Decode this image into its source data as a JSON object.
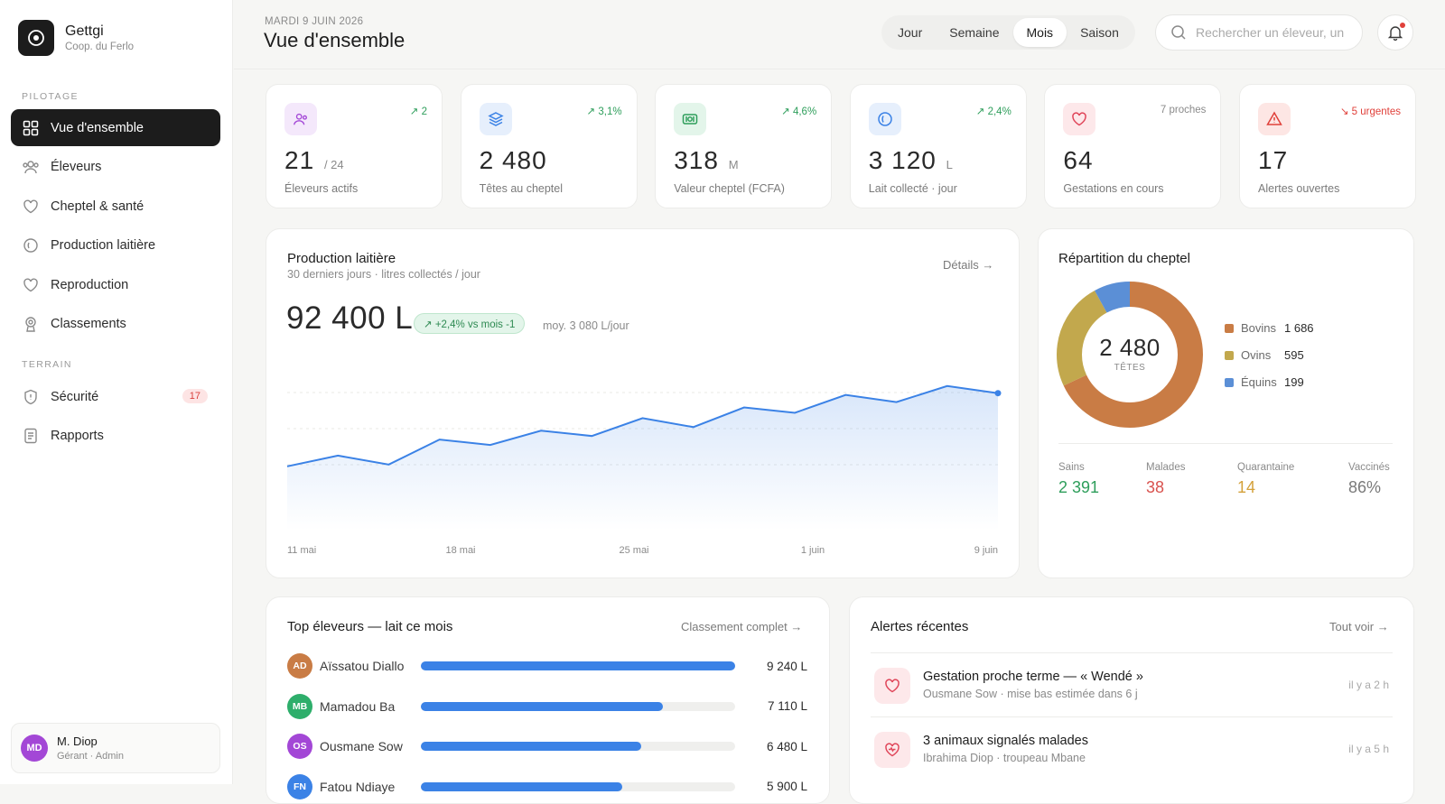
{
  "brand": {
    "name": "Gettgi",
    "sub": "Coop. du Ferlo"
  },
  "sidebar": {
    "section_pilotage": "PILOTAGE",
    "section_terrain": "TERRAIN",
    "items": [
      {
        "label": "Vue d'ensemble",
        "icon": "grid-icon"
      },
      {
        "label": "Éleveurs",
        "icon": "users-icon"
      },
      {
        "label": "Cheptel & santé",
        "icon": "heart-icon"
      },
      {
        "label": "Production laitière",
        "icon": "drop-icon"
      },
      {
        "label": "Reproduction",
        "icon": "heart-icon"
      },
      {
        "label": "Classements",
        "icon": "trophy-icon"
      }
    ],
    "terrain_items": [
      {
        "label": "Sécurité",
        "icon": "shield-icon",
        "badge": "17"
      },
      {
        "label": "Rapports",
        "icon": "document-icon"
      }
    ]
  },
  "user": {
    "initials": "MD",
    "name": "M. Diop",
    "role": "Gérant · Admin"
  },
  "header": {
    "date": "MARDI 9 JUIN 2026",
    "title": "Vue d'ensemble",
    "periods": [
      "Jour",
      "Semaine",
      "Mois",
      "Saison"
    ],
    "active_period": "Mois",
    "search_placeholder": "Rechercher un éleveur, un"
  },
  "kpis": [
    {
      "value": "21",
      "unit": "/ 24",
      "label": "Éleveurs actifs",
      "delta": "↗ 2",
      "icon": "users-icon",
      "color": "#a347d6",
      "bg": "#f4e8fb",
      "delta_color": "#2e9e5b"
    },
    {
      "value": "2 480",
      "unit": "",
      "label": "Têtes au cheptel",
      "delta": "↗ 3,1%",
      "icon": "layers-icon",
      "color": "#3b82e6",
      "bg": "#e6effc",
      "delta_color": "#2e9e5b"
    },
    {
      "value": "318",
      "unit": "M",
      "label": "Valeur cheptel (FCFA)",
      "delta": "↗ 4,6%",
      "icon": "banknote-icon",
      "color": "#2e9e5b",
      "bg": "#e3f5ea",
      "delta_color": "#2e9e5b"
    },
    {
      "value": "3 120",
      "unit": "L",
      "label": "Lait collecté · jour",
      "delta": "↗ 2,4%",
      "icon": "drop-icon",
      "color": "#3b82e6",
      "bg": "#e6effc",
      "delta_color": "#2e9e5b"
    },
    {
      "value": "64",
      "unit": "",
      "label": "Gestations en cours",
      "delta": "7 proches",
      "icon": "heart-icon",
      "color": "#e0465a",
      "bg": "#fde8ea",
      "delta_color": "#8a8a8a"
    },
    {
      "value": "17",
      "unit": "",
      "label": "Alertes ouvertes",
      "delta": "↘ 5 urgentes",
      "icon": "warning-icon",
      "color": "#e0403a",
      "bg": "#fde6e4",
      "delta_color": "#e0403a"
    }
  ],
  "production": {
    "title": "Production laitière",
    "subtitle": "30 derniers jours · litres collectés / jour",
    "details": "Détails →",
    "total": "92 400 L",
    "trend": "↗ +2,4% vs mois -1",
    "avg": "moy. 3 080 L/jour"
  },
  "chart_data": {
    "type": "area",
    "title": "Production laitière",
    "x_ticks": [
      "11 mai",
      "18 mai",
      "25 mai",
      "1 juin",
      "9 juin"
    ],
    "values": [
      2860,
      2920,
      2870,
      3010,
      2980,
      3060,
      3030,
      3130,
      3080,
      3190,
      3160,
      3260,
      3220,
      3310,
      3270
    ],
    "ylim": [
      2500,
      3400
    ],
    "color": "#3b82e6"
  },
  "repartition": {
    "title": "Répartition du cheptel",
    "center_value": "2 480",
    "center_label": "TÊTES",
    "segments": [
      {
        "name": "Bovins",
        "value": 1686,
        "display": "1 686",
        "color": "#c97c45"
      },
      {
        "name": "Ovins",
        "value": 595,
        "display": "595",
        "color": "#c2a84d"
      },
      {
        "name": "Équins",
        "value": 199,
        "display": "199",
        "color": "#5b8fd6"
      }
    ],
    "stats": [
      {
        "label": "Sains",
        "value": "2 391",
        "color": "#2e9e5b"
      },
      {
        "label": "Malades",
        "value": "38",
        "color": "#d9534f"
      },
      {
        "label": "Quarantaine",
        "value": "14",
        "color": "#d4a13a"
      },
      {
        "label": "Vaccinés",
        "value": "86%",
        "color": "#7a7a7a"
      }
    ]
  },
  "top_eleveurs": {
    "title": "Top éleveurs — lait ce mois",
    "link": "Classement complet →",
    "rows": [
      {
        "initials": "AD",
        "name": "Aïssatou Diallo",
        "value": "9 240 L",
        "fraction": 1.0,
        "color": "#c97c45"
      },
      {
        "initials": "MB",
        "name": "Mamadou Ba",
        "value": "7 110 L",
        "fraction": 0.77,
        "color": "#2eae6b"
      },
      {
        "initials": "OS",
        "name": "Ousmane Sow",
        "value": "6 480 L",
        "fraction": 0.7,
        "color": "#a347d6"
      },
      {
        "initials": "FN",
        "name": "Fatou Ndiaye",
        "value": "5 900 L",
        "fraction": 0.64,
        "color": "#3b82e6"
      }
    ]
  },
  "alertes": {
    "title": "Alertes récentes",
    "link": "Tout voir →",
    "items": [
      {
        "title": "Gestation proche terme — « Wendé »",
        "sub": "Ousmane Sow · mise bas estimée dans 6 j",
        "time": "il y a 2 h",
        "icon": "heart-icon"
      },
      {
        "title": "3 animaux signalés malades",
        "sub": "Ibrahima Diop · troupeau Mbane",
        "time": "il y a 5 h",
        "icon": "heart-pulse-icon"
      }
    ]
  }
}
